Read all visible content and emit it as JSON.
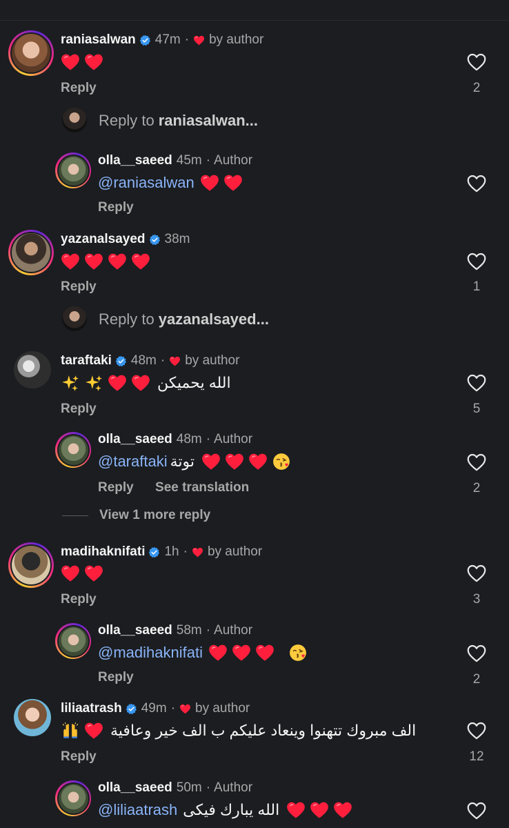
{
  "comments": [
    {
      "username": "raniasalwan",
      "time": "47m",
      "by_author": "by author",
      "text": "",
      "likes": "2",
      "reply": "Reply"
    },
    {
      "username": "olla__saeed",
      "time": "45m",
      "tag": "Author",
      "mention": "@raniasalwan",
      "text": "",
      "reply": "Reply"
    },
    {
      "username": "yazanalsayed",
      "time": "38m",
      "text": "",
      "likes": "1",
      "reply": "Reply"
    },
    {
      "username": "taraftaki",
      "time": "48m",
      "by_author": "by author",
      "text": "الله يحميكن",
      "likes": "5",
      "reply": "Reply"
    },
    {
      "username": "olla__saeed",
      "time": "48m",
      "tag": "Author",
      "mention": "@taraftaki",
      "text": "توتة",
      "likes": "2",
      "reply": "Reply",
      "translation": "See translation"
    },
    {
      "username": "madihaknifati",
      "time": "1h",
      "by_author": "by author",
      "text": "",
      "likes": "3",
      "reply": "Reply"
    },
    {
      "username": "olla__saeed",
      "time": "58m",
      "tag": "Author",
      "mention": "@madihaknifati",
      "text": "",
      "likes": "2",
      "reply": "Reply"
    },
    {
      "username": "liliaatrash",
      "time": "49m",
      "by_author": "by author",
      "text": "الف مبروك تتهنوا وينعاد عليكم ب الف خير وعافية",
      "likes": "12",
      "reply": "Reply"
    },
    {
      "username": "olla__saeed",
      "time": "50m",
      "tag": "Author",
      "mention": "@liliaatrash",
      "text": "الله يبارك فيكى"
    }
  ],
  "reply_to": [
    {
      "prefix": "Reply to",
      "user": "raniasalwan..."
    },
    {
      "prefix": "Reply to",
      "user": "yazanalsayed..."
    }
  ],
  "view_more": "View 1 more reply",
  "colors": {
    "background": "#1b1d21",
    "mention": "#8ab4f8",
    "heart": "#ff3040",
    "verified": "#3897f0",
    "muted": "#a8a8a8"
  }
}
